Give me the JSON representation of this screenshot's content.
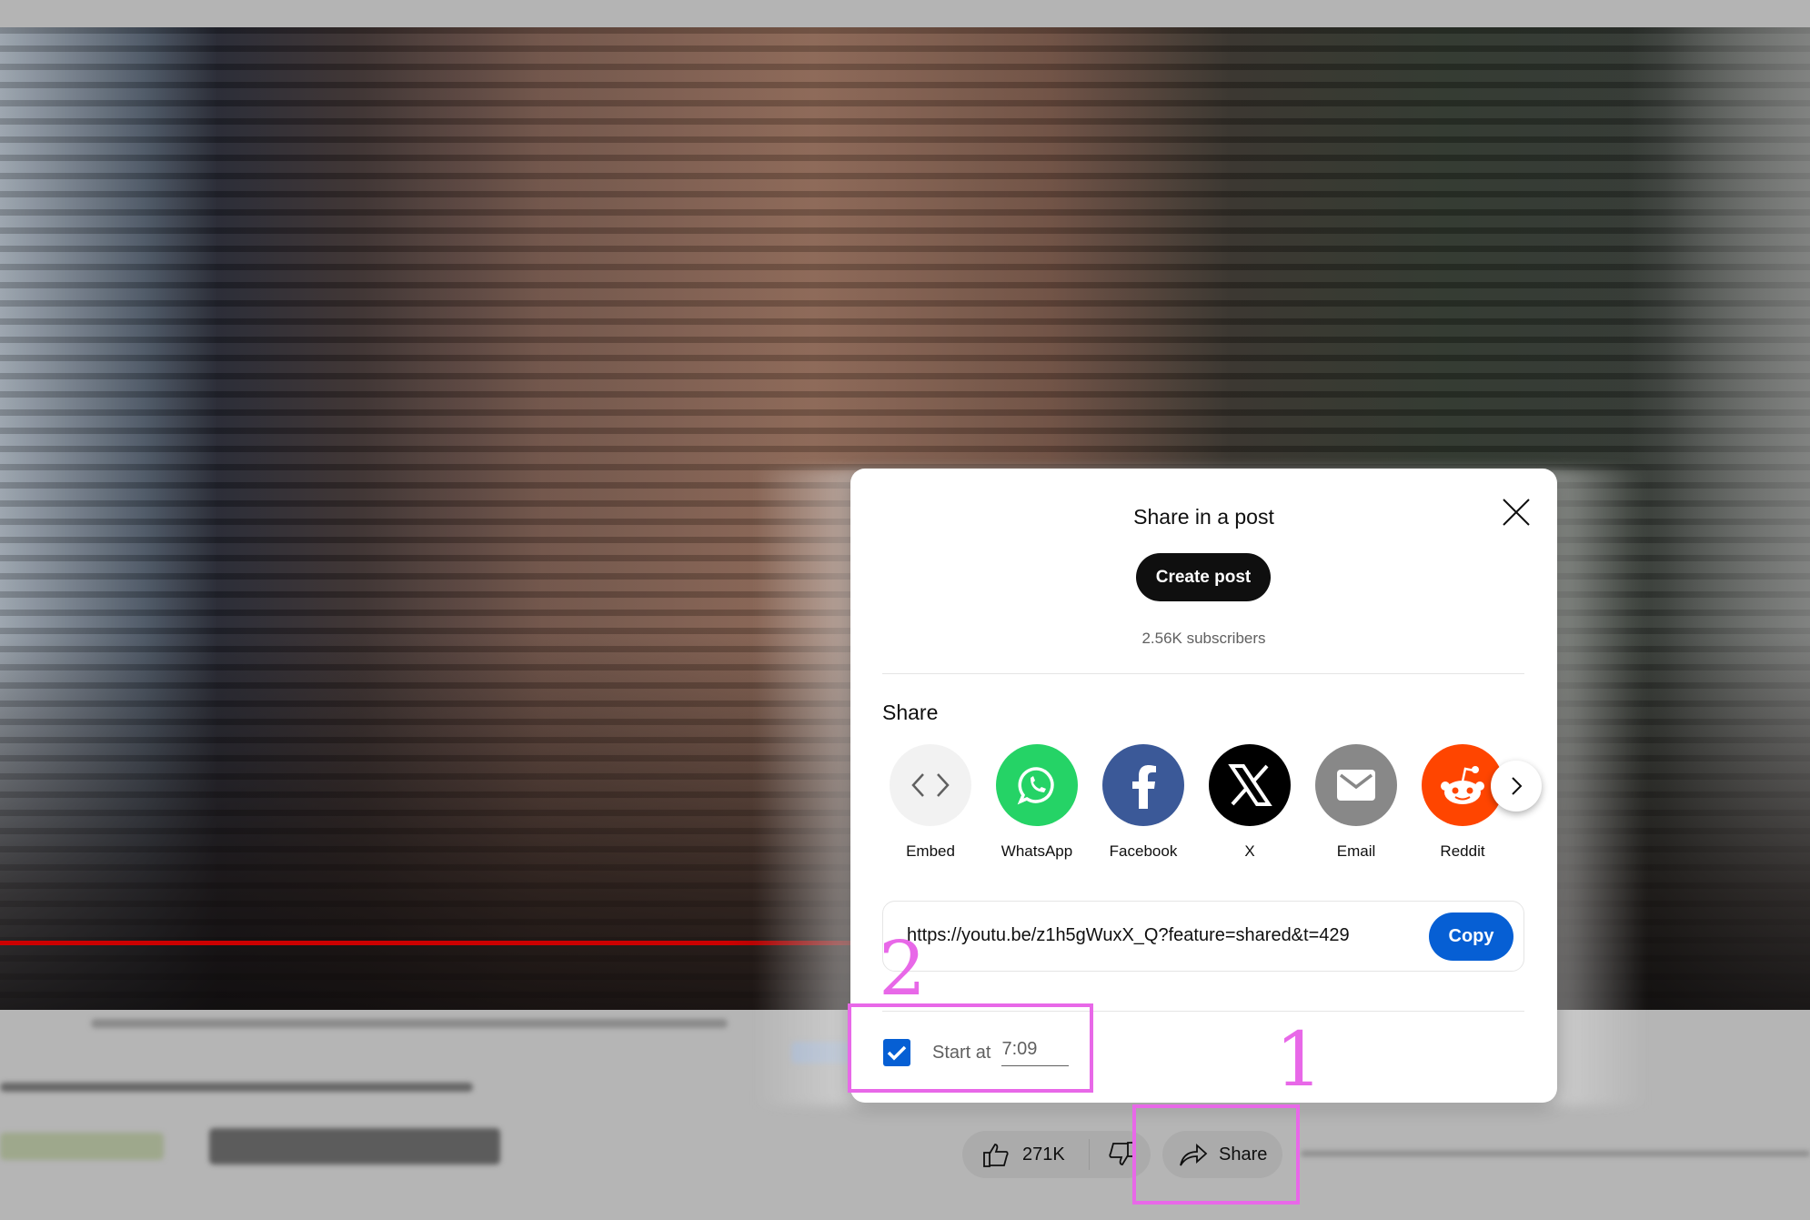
{
  "video": {
    "progress_fraction": 0.5
  },
  "dialog": {
    "title": "Share in a post",
    "create_post_label": "Create post",
    "subscribers": "2.56K subscribers",
    "share_label": "Share",
    "targets": [
      {
        "label": "Embed",
        "icon": "embed-icon",
        "color": "#f2f2f2"
      },
      {
        "label": "WhatsApp",
        "icon": "whatsapp-icon",
        "color": "#25d366"
      },
      {
        "label": "Facebook",
        "icon": "facebook-icon",
        "color": "#3b5998"
      },
      {
        "label": "X",
        "icon": "x-icon",
        "color": "#000000"
      },
      {
        "label": "Email",
        "icon": "email-icon",
        "color": "#888888"
      },
      {
        "label": "Reddit",
        "icon": "reddit-icon",
        "color": "#ff4500"
      }
    ],
    "url": "https://youtu.be/z1h5gWuxX_Q?feature=shared&t=429",
    "copy_label": "Copy",
    "start_at_label": "Start at",
    "start_at_value": "7:09",
    "start_at_checked": true
  },
  "actions": {
    "like_count": "271K",
    "share_label": "Share"
  },
  "annotations": {
    "one": "1",
    "two": "2",
    "color": "#e868e8"
  },
  "colors": {
    "primary_blue": "#065fd4",
    "text_primary": "#0f0f0f",
    "text_secondary": "#606060"
  }
}
